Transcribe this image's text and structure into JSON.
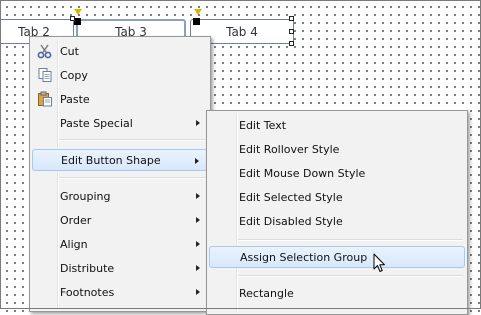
{
  "tabs": [
    {
      "label": "Tab 2"
    },
    {
      "label": "Tab 3"
    },
    {
      "label": "Tab 4"
    }
  ],
  "context_menu": {
    "items": [
      {
        "label": "Cut",
        "icon": "scissors-icon"
      },
      {
        "label": "Copy",
        "icon": "copy-icon"
      },
      {
        "label": "Paste",
        "icon": "paste-icon"
      },
      {
        "label": "Paste Special",
        "has_submenu": true
      },
      {
        "label": "Edit Button Shape",
        "has_submenu": true,
        "highlighted": true
      },
      {
        "label": "Grouping",
        "has_submenu": true
      },
      {
        "label": "Order",
        "has_submenu": true
      },
      {
        "label": "Align",
        "has_submenu": true
      },
      {
        "label": "Distribute",
        "has_submenu": true
      },
      {
        "label": "Footnotes",
        "has_submenu": true
      }
    ]
  },
  "submenu": {
    "items": [
      {
        "label": "Edit Text"
      },
      {
        "label": "Edit Rollover Style"
      },
      {
        "label": "Edit Mouse Down Style"
      },
      {
        "label": "Edit Selected Style"
      },
      {
        "label": "Edit Disabled Style"
      },
      {
        "label": "Assign Selection Group",
        "highlighted": true
      },
      {
        "label": "Rectangle"
      }
    ]
  },
  "colors": {
    "highlight_border": "#a8c8ee",
    "menu_background": "#f2f2f2",
    "tab_border": "#6b7fa8",
    "pin": "#d8b400"
  }
}
